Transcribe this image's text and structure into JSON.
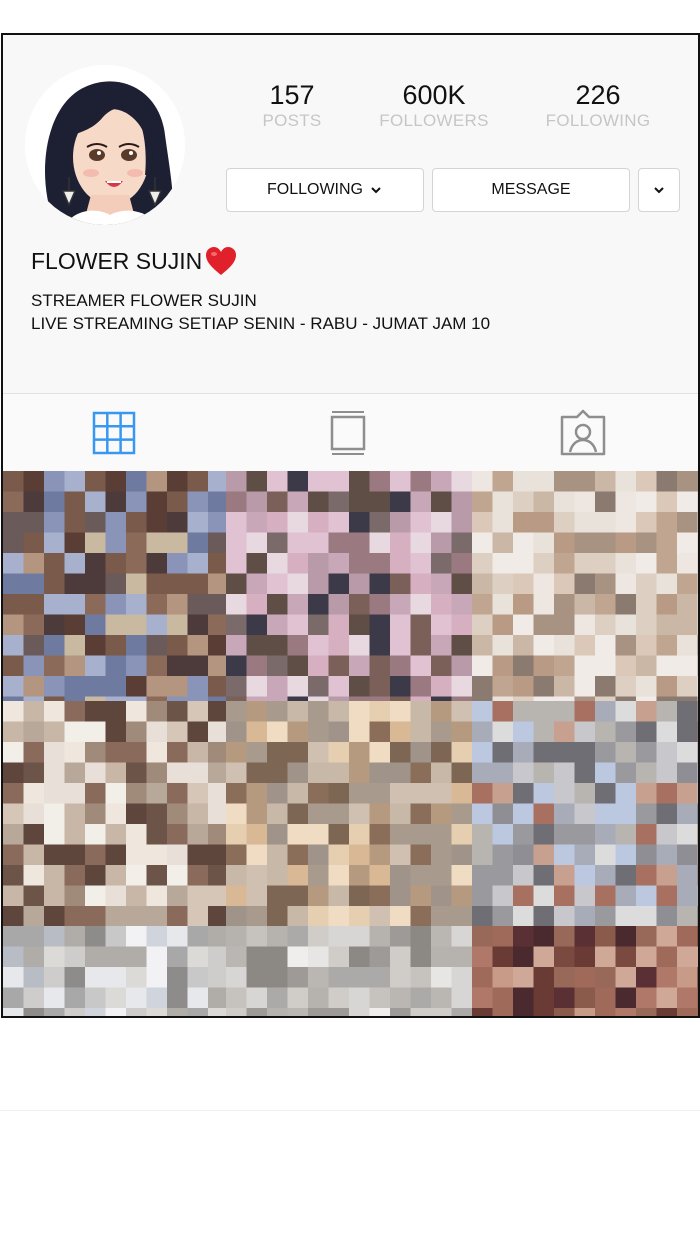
{
  "profile": {
    "username": "FLOWER SUJIN",
    "name_emoji": "heart-emoji",
    "bio_line1": "STREAMER FLOWER SUJIN",
    "bio_line2": "LIVE STREAMING SETIAP SENIN - RABU - JUMAT JAM 10"
  },
  "stats": {
    "posts_count": "157",
    "posts_label": "POSTS",
    "followers_count": "600K",
    "followers_label": "FOLLOWERS",
    "following_count": "226",
    "following_label": "FOLLOWING"
  },
  "actions": {
    "following_label": "FOLLOWING",
    "message_label": "MESSAGE",
    "more_icon": "chevron-down-icon"
  },
  "tabs": [
    {
      "icon": "grid-icon",
      "active": true
    },
    {
      "icon": "feed-icon",
      "active": false
    },
    {
      "icon": "tagged-icon",
      "active": false
    }
  ],
  "colors": {
    "active_tab": "#3897f0",
    "inactive_tab": "#8e8e8e",
    "stat_label": "#c6c6c6",
    "heart": "#e0202a"
  },
  "posts": [
    {
      "content": "pixelated-photo"
    },
    {
      "content": "pixelated-photo"
    },
    {
      "content": "pixelated-photo"
    },
    {
      "content": "pixelated-photo"
    },
    {
      "content": "pixelated-photo"
    },
    {
      "content": "pixelated-photo"
    },
    {
      "content": "pixelated-photo"
    },
    {
      "content": "pixelated-photo"
    },
    {
      "content": "pixelated-photo"
    }
  ]
}
